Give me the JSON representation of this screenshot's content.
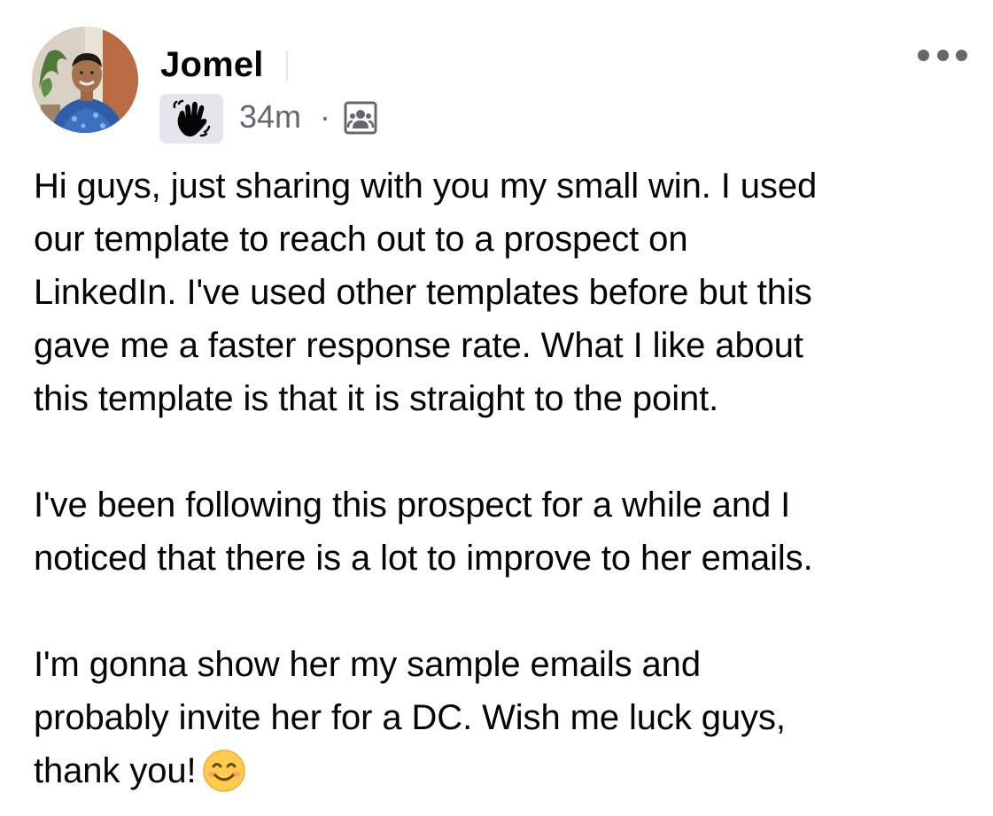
{
  "post": {
    "author": {
      "name": "Jomel",
      "avatar_icon": "profile-photo"
    },
    "badge_icon": "waving-hand-icon",
    "timestamp": "34m",
    "separator": "·",
    "audience_icon": "group-members-icon",
    "more_icon": "more-options-icon",
    "body": {
      "paragraph_1": "Hi guys, just sharing with you my small win. I used\nour template to reach out to a prospect on\nLinkedIn. I've used other templates before but this\ngave me a faster response rate. What I like about\nthis template is that it is straight to the point.",
      "paragraph_2": "I've been following this prospect for a while and I\nnoticed that there is a lot to improve to her emails.",
      "paragraph_3": "I'm gonna show her my sample emails and\nprobably invite her for a DC. Wish me luck guys,\nthank you!"
    },
    "emoji_icon": "smiling-face-emoji",
    "colors": {
      "text_primary": "#050505",
      "text_secondary": "#65676b",
      "badge_background": "#e4e6eb",
      "emoji_yellow": "#ffcc4d"
    }
  }
}
